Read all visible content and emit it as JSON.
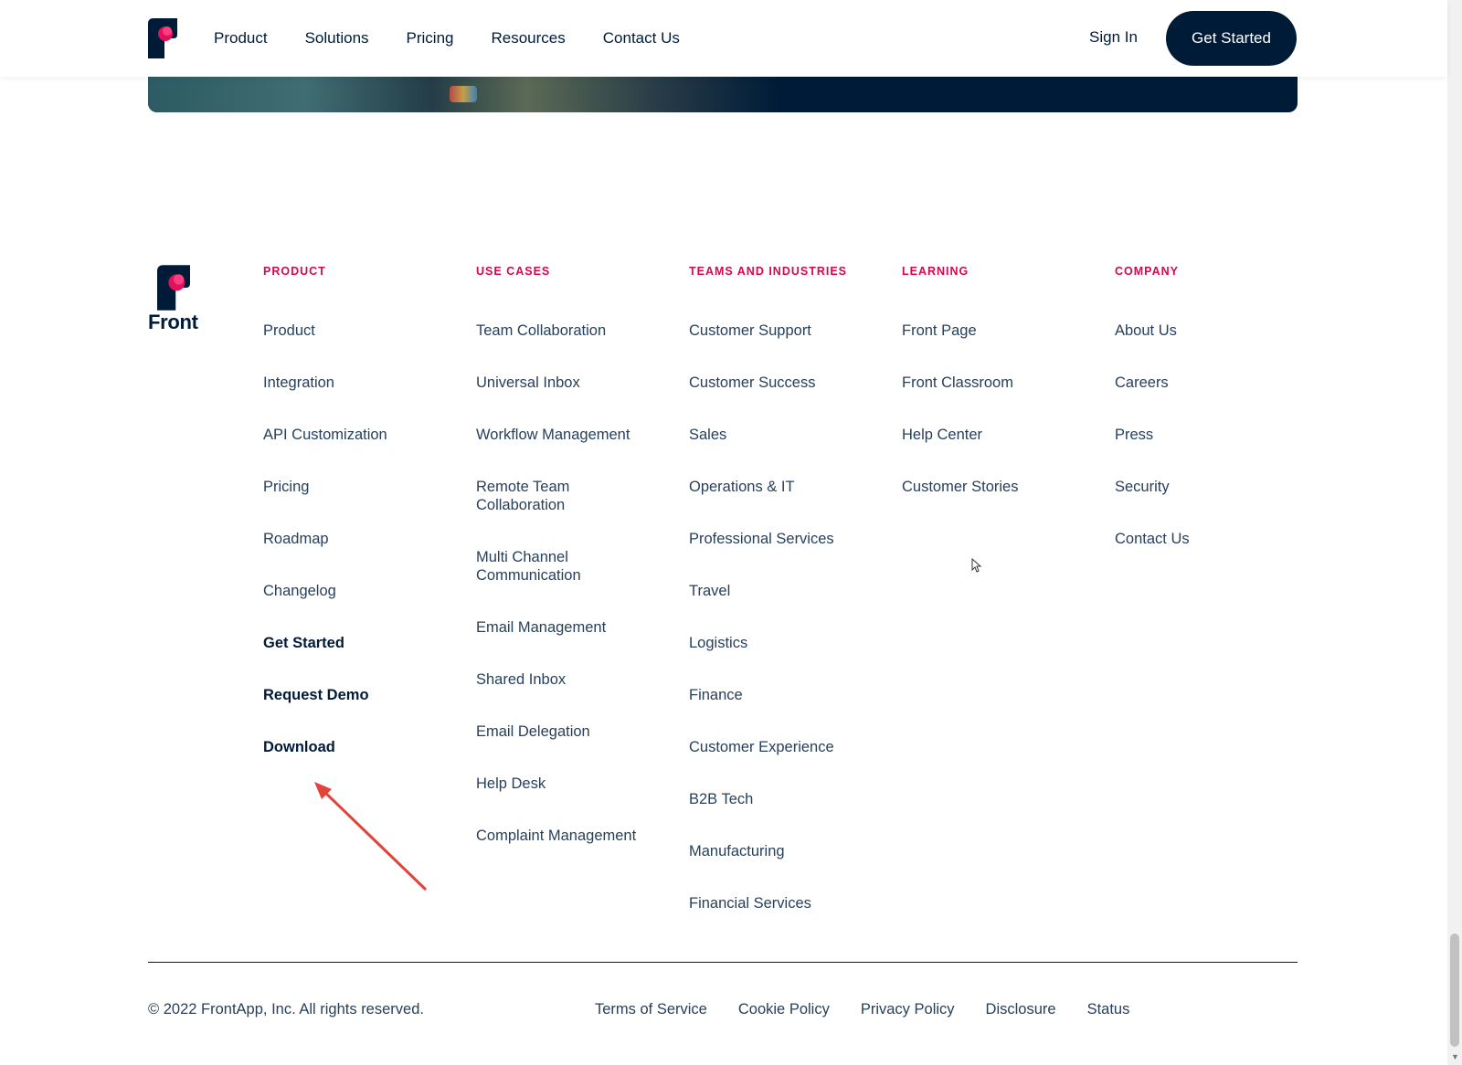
{
  "header": {
    "nav": [
      "Product",
      "Solutions",
      "Pricing",
      "Resources",
      "Contact Us"
    ],
    "sign_in": "Sign In",
    "cta": "Get Started"
  },
  "footer": {
    "logo_word": "Front",
    "columns": [
      {
        "title": "PRODUCT",
        "links": [
          "Product",
          "Integration",
          "API Customization",
          "Pricing",
          "Roadmap",
          "Changelog",
          "Get Started",
          "Request Demo",
          "Download"
        ]
      },
      {
        "title": "USE CASES",
        "links": [
          "Team Collaboration",
          "Universal Inbox",
          "Workflow Management",
          "Remote Team Collaboration",
          "Multi Channel Communication",
          "Email Management",
          "Shared Inbox",
          "Email Delegation",
          "Help Desk",
          "Complaint Management"
        ]
      },
      {
        "title": "TEAMS AND INDUSTRIES",
        "links": [
          "Customer Support",
          "Customer Success",
          "Sales",
          "Operations & IT",
          "Professional Services",
          "Travel",
          "Logistics",
          "Finance",
          "Customer Experience",
          "B2B Tech",
          "Manufacturing",
          "Financial Services"
        ]
      },
      {
        "title": "LEARNING",
        "links": [
          "Front Page",
          "Front Classroom",
          "Help Center",
          "Customer Stories"
        ]
      },
      {
        "title": "COMPANY",
        "links": [
          "About Us",
          "Careers",
          "Press",
          "Security",
          "Contact Us"
        ]
      }
    ],
    "copyright": "© 2022 FrontApp, Inc. All rights reserved.",
    "legal": [
      "Terms of Service",
      "Cookie Policy",
      "Privacy Policy",
      "Disclosure",
      "Status"
    ]
  },
  "colors": {
    "navy": "#001b38",
    "accent": "#d5084b",
    "annotation_arrow": "#e0443b"
  }
}
